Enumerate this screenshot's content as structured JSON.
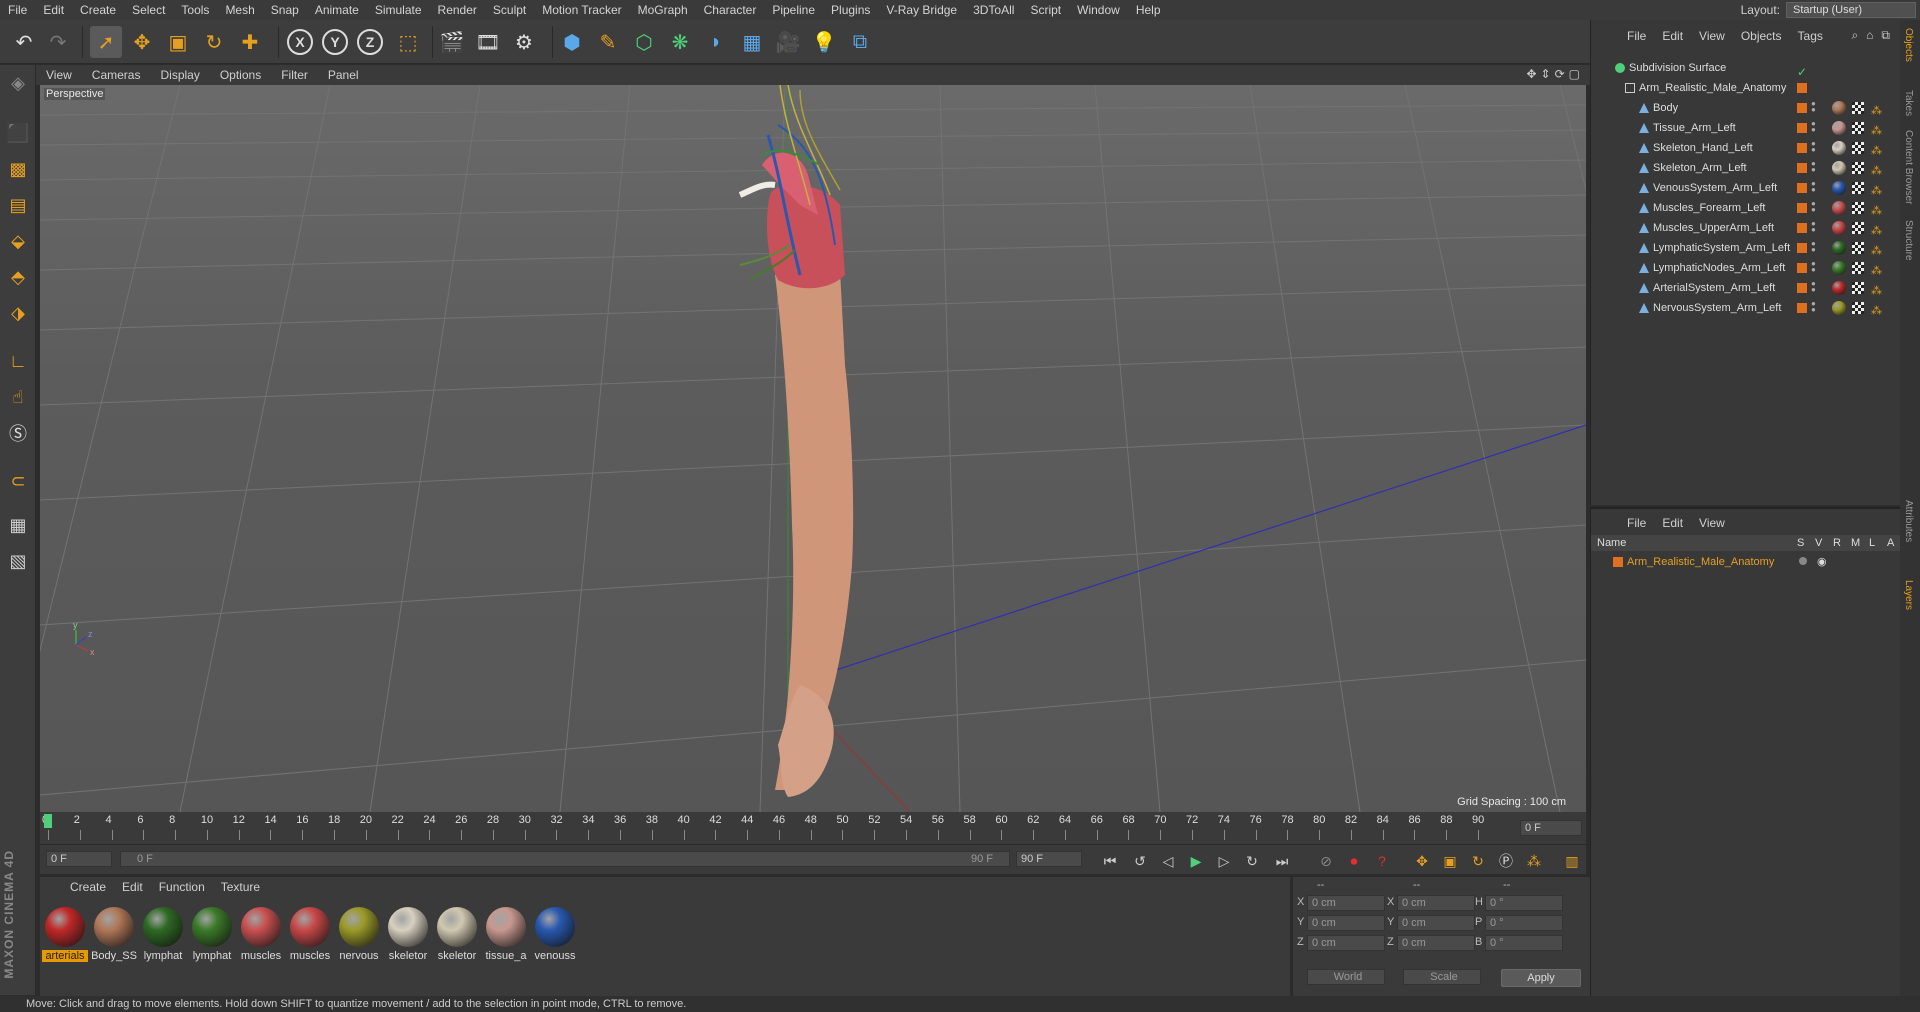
{
  "menubar": [
    "File",
    "Edit",
    "Create",
    "Select",
    "Tools",
    "Mesh",
    "Snap",
    "Animate",
    "Simulate",
    "Render",
    "Sculpt",
    "Motion Tracker",
    "MoGraph",
    "Character",
    "Pipeline",
    "Plugins",
    "V-Ray Bridge",
    "3DToAll",
    "Script",
    "Window",
    "Help"
  ],
  "layout": {
    "label": "Layout:",
    "value": "Startup (User)"
  },
  "viewport": {
    "menu": [
      "View",
      "Cameras",
      "Display",
      "Options",
      "Filter",
      "Panel"
    ],
    "label": "Perspective",
    "grid_spacing": "Grid Spacing : 100 cm"
  },
  "timeline": {
    "ticks": [
      "0",
      "2",
      "4",
      "6",
      "8",
      "10",
      "12",
      "14",
      "16",
      "18",
      "20",
      "22",
      "24",
      "26",
      "28",
      "30",
      "32",
      "34",
      "36",
      "38",
      "40",
      "42",
      "44",
      "46",
      "48",
      "50",
      "52",
      "54",
      "56",
      "58",
      "60",
      "62",
      "64",
      "66",
      "68",
      "70",
      "72",
      "74",
      "76",
      "78",
      "80",
      "82",
      "84",
      "86",
      "88",
      "90"
    ],
    "current_frame": "0 F"
  },
  "playbar": {
    "start": "0 F",
    "range_start": "0 F",
    "range_end": "90 F",
    "end": "90 F"
  },
  "materials": {
    "menu": [
      "Create",
      "Edit",
      "Function",
      "Texture"
    ],
    "items": [
      {
        "name": "arterials",
        "color": "#c02828",
        "selected": true
      },
      {
        "name": "Body_SS",
        "color": "#b07858",
        "selected": false
      },
      {
        "name": "lymphat",
        "color": "#2d6a22",
        "selected": false
      },
      {
        "name": "lymphat",
        "color": "#3a7a28",
        "selected": false
      },
      {
        "name": "muscles",
        "color": "#c85050",
        "selected": false
      },
      {
        "name": "muscles",
        "color": "#c84848",
        "selected": false
      },
      {
        "name": "nervous",
        "color": "#9a9a28",
        "selected": false
      },
      {
        "name": "skeletor",
        "color": "#d8d0c0",
        "selected": false
      },
      {
        "name": "skeletor",
        "color": "#d0c8b0",
        "selected": false
      },
      {
        "name": "tissue_a",
        "color": "#c89890",
        "selected": false
      },
      {
        "name": "venouss",
        "color": "#2858b0",
        "selected": false
      }
    ]
  },
  "coords": {
    "headers": [
      "--",
      "--",
      "--"
    ],
    "rows": [
      {
        "a": "X",
        "av": "0 cm",
        "b": "X",
        "bv": "0 cm",
        "c": "H",
        "cv": "0 °"
      },
      {
        "a": "Y",
        "av": "0 cm",
        "b": "Y",
        "bv": "0 cm",
        "c": "P",
        "cv": "0 °"
      },
      {
        "a": "Z",
        "av": "0 cm",
        "b": "Z",
        "bv": "0 cm",
        "c": "B",
        "cv": "0 °"
      }
    ],
    "world": "World",
    "scale": "Scale",
    "apply": "Apply"
  },
  "status": "Move: Click and drag to move elements. Hold down SHIFT to quantize movement / add to the selection in point mode, CTRL to remove.",
  "objects": {
    "menu": [
      "File",
      "Edit",
      "View",
      "Objects",
      "Tags"
    ],
    "root": "Subdivision Surface",
    "group": "Arm_Realistic_Male_Anatomy",
    "items": [
      {
        "name": "Body",
        "mat": "#b07858"
      },
      {
        "name": "Tissue_Arm_Left",
        "mat": "#c89890"
      },
      {
        "name": "Skeleton_Hand_Left",
        "mat": "#d8d0c0"
      },
      {
        "name": "Skeleton_Arm_Left",
        "mat": "#d0c8b0"
      },
      {
        "name": "VenousSystem_Arm_Left",
        "mat": "#2858b0"
      },
      {
        "name": "Muscles_Forearm_Left",
        "mat": "#c85050"
      },
      {
        "name": "Muscles_UpperArm_Left",
        "mat": "#c84848"
      },
      {
        "name": "LymphaticSystem_Arm_Left",
        "mat": "#2d6a22"
      },
      {
        "name": "LymphaticNodes_Arm_Left",
        "mat": "#3a7a28"
      },
      {
        "name": "ArterialSystem_Arm_Left",
        "mat": "#c02828"
      },
      {
        "name": "NervousSystem_Arm_Left",
        "mat": "#9a9a28"
      }
    ]
  },
  "layers": {
    "menu": [
      "File",
      "Edit",
      "View"
    ],
    "columns": [
      "Name",
      "S",
      "V",
      "R",
      "M",
      "L",
      "A"
    ],
    "row": "Arm_Realistic_Male_Anatomy"
  },
  "sidetabs": [
    "Objects",
    "Takes",
    "Content Browser",
    "Structure",
    "Attributes",
    "Layers"
  ],
  "brand": "MAXON CINEMA 4D"
}
